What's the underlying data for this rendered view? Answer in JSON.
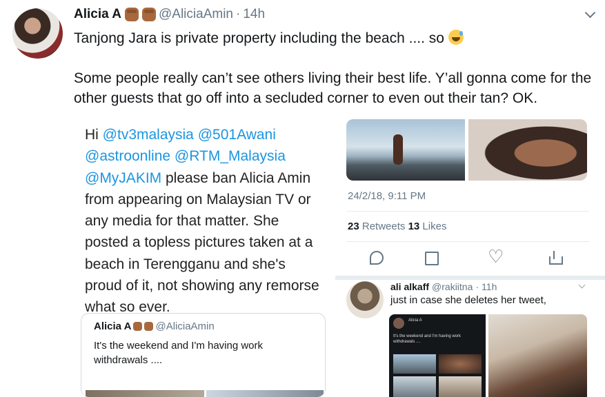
{
  "tweet": {
    "author_name": "Alicia A",
    "handle": "@AliciaAmin",
    "separator": "·",
    "time": "14h",
    "line1": "Tanjong Jara is private property including the beach .... so",
    "line2": "Some people really can’t see others living their best life. Y’all gonna come for the other guests that go off into a secluded corner to even out their tan? OK."
  },
  "left_image": {
    "greeting": "Hi ",
    "mentions": [
      "@tv3malaysia",
      "@501Awani",
      "@astroonline",
      "@RTM_Malaysia",
      "@MyJAKIM"
    ],
    "body": " please ban Alicia Amin from appearing on Malaysian TV or any media for that matter. She posted a topless pictures taken at a beach in Terengganu and she's proud of it, not showing any remorse what so ever.",
    "embedded": {
      "name": "Alicia A",
      "handle": "@AliciaAmin",
      "text": "It's the weekend and I'm having work withdrawals ...."
    }
  },
  "right_image": {
    "date": "24/2/18, 9:11 PM",
    "retweets_count": "23",
    "retweets_label": "Retweets",
    "likes_count": "13",
    "likes_label": "Likes",
    "reply": {
      "name": "ali alkaff",
      "handle": "@rakiitna",
      "separator": "·",
      "time": "11h",
      "text": "just in case she deletes her tweet,"
    },
    "mini": {
      "name": "Alicia A",
      "text": "It's the weekend and I'm having work withdrawals ...."
    }
  }
}
